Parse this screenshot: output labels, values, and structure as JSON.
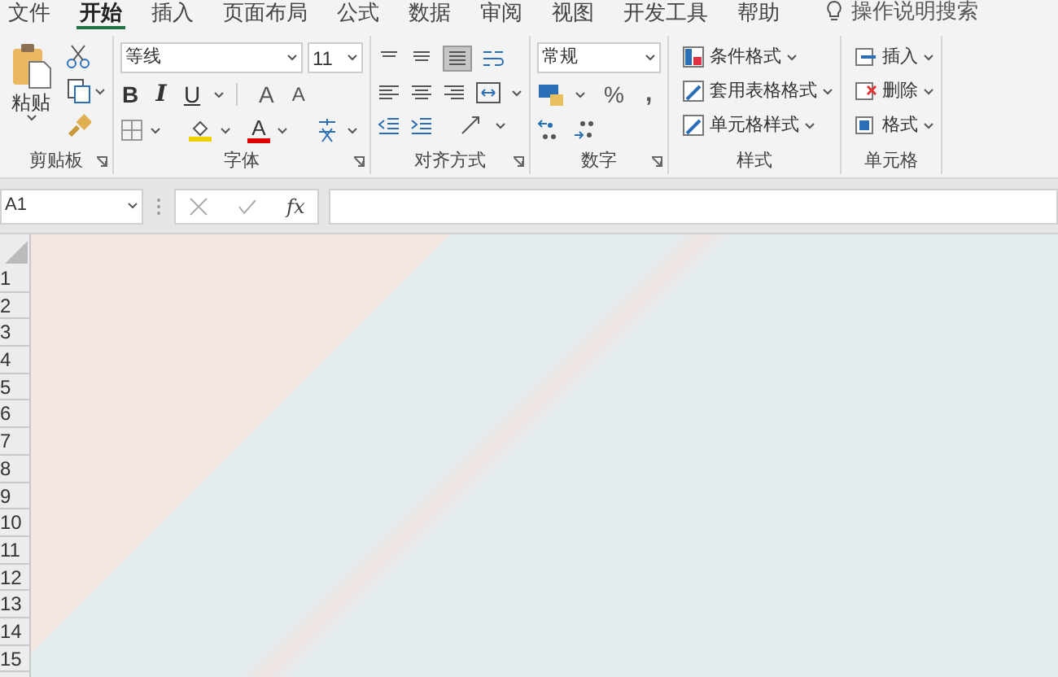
{
  "tabs": [
    {
      "label": "文件",
      "selected": false
    },
    {
      "label": "开始",
      "selected": true
    },
    {
      "label": "插入",
      "selected": false
    },
    {
      "label": "页面布局",
      "selected": false
    },
    {
      "label": "公式",
      "selected": false
    },
    {
      "label": "数据",
      "selected": false
    },
    {
      "label": "审阅",
      "selected": false
    },
    {
      "label": "视图",
      "selected": false
    },
    {
      "label": "开发工具",
      "selected": false
    },
    {
      "label": "帮助",
      "selected": false
    }
  ],
  "tell_me": "操作说明搜索",
  "clipboard": {
    "paste": "粘贴",
    "label": "剪贴板"
  },
  "font": {
    "name": "等线",
    "size": "11",
    "bold": "B",
    "italic": "I",
    "underline": "U",
    "grow": "A",
    "shrink": "A",
    "font_color": "A",
    "label": "字体"
  },
  "alignment": {
    "label": "对齐方式"
  },
  "number": {
    "format": "常规",
    "percent": "%",
    "comma": ",",
    "label": "数字"
  },
  "styles": {
    "items": [
      "条件格式",
      "套用表格格式",
      "单元格样式"
    ],
    "label": "样式"
  },
  "cells": {
    "items": [
      "插入",
      "删除",
      "格式"
    ],
    "label": "单元格"
  },
  "formula_bar": {
    "name_box": "A1",
    "fx": "fx"
  },
  "rows": [
    "1",
    "2",
    "3",
    "4",
    "5",
    "6",
    "7",
    "8",
    "9",
    "10",
    "11",
    "12",
    "13",
    "14",
    "15"
  ]
}
